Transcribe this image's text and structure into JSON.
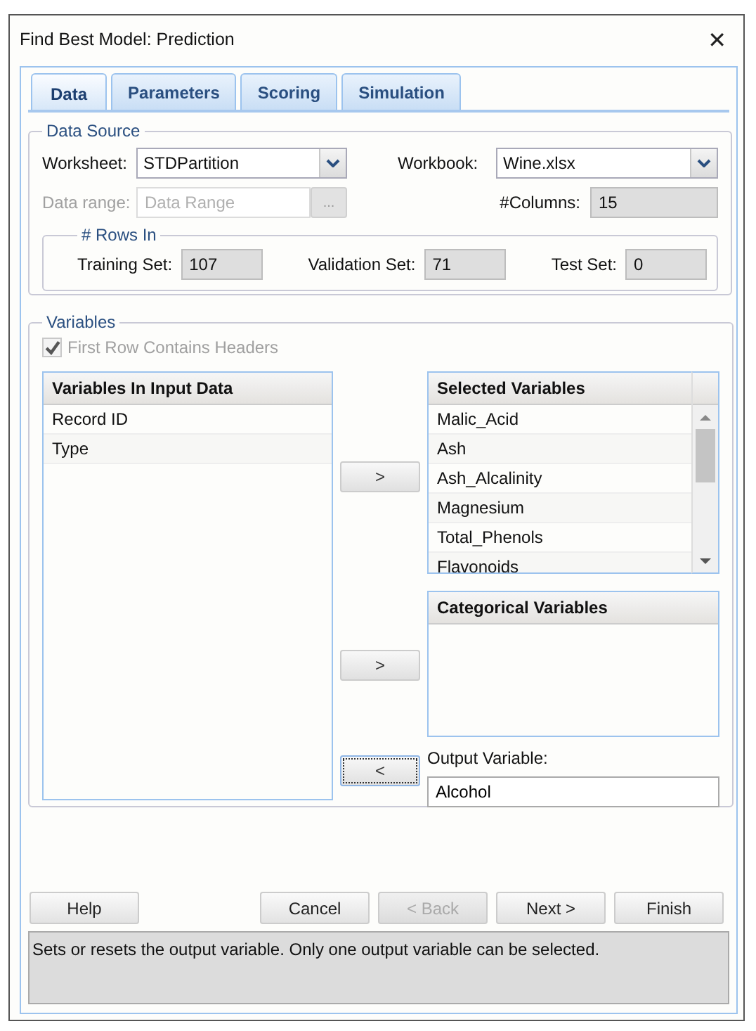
{
  "window": {
    "title": "Find Best Model: Prediction",
    "close": "✕"
  },
  "tabs": [
    {
      "label": "Data",
      "selected": true
    },
    {
      "label": "Parameters",
      "selected": false
    },
    {
      "label": "Scoring",
      "selected": false
    },
    {
      "label": "Simulation",
      "selected": false
    }
  ],
  "data_source": {
    "title": "Data Source",
    "worksheet": {
      "label": "Worksheet:",
      "value": "STDPartition"
    },
    "workbook": {
      "label": "Workbook:",
      "value": "Wine.xlsx"
    },
    "data_range": {
      "label": "Data range:",
      "placeholder": "Data Range",
      "disabled": true,
      "browse": "..."
    },
    "columns": {
      "label": "#Columns:",
      "value": "15"
    },
    "rows_in": {
      "title": "# Rows In",
      "fields": [
        {
          "label": "Training Set:",
          "value": "107"
        },
        {
          "label": "Validation Set:",
          "value": "71"
        },
        {
          "label": "Test Set:",
          "value": "0"
        }
      ]
    }
  },
  "variables": {
    "title": "Variables",
    "first_row_headers": {
      "label": "First Row Contains Headers",
      "checked": true,
      "disabled": true
    },
    "input_list": {
      "header": "Variables In Input Data",
      "items": [
        {
          "label": "Record ID",
          "selected": false
        },
        {
          "label": "Type",
          "selected": false
        }
      ]
    },
    "selected_list": {
      "header": "Selected Variables",
      "items": [
        {
          "label": "Malic_Acid",
          "selected": false
        },
        {
          "label": "Ash",
          "selected": false
        },
        {
          "label": "Ash_Alcalinity",
          "selected": false
        },
        {
          "label": "Magnesium",
          "selected": false
        },
        {
          "label": "Total_Phenols",
          "selected": false
        },
        {
          "label": "Flavonoids",
          "selected": false
        }
      ]
    },
    "categorical_list": {
      "header": "Categorical Variables"
    },
    "move_buttons": [
      {
        "label": ">",
        "focused": false
      },
      {
        "label": ">",
        "focused": false
      },
      {
        "label": "<",
        "focused": true
      }
    ],
    "output_variable": {
      "label": "Output Variable:",
      "value": "Alcohol"
    }
  },
  "buttons": [
    {
      "label": "Help",
      "disabled": false
    },
    {
      "label": "Cancel",
      "disabled": false
    },
    {
      "label": "< Back",
      "disabled": true
    },
    {
      "label": "Next >",
      "disabled": false
    },
    {
      "label": "Finish",
      "disabled": false
    }
  ],
  "status": "Sets or resets the output variable. Only one output variable can be selected."
}
